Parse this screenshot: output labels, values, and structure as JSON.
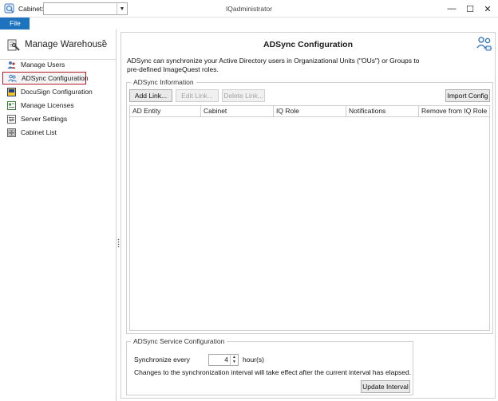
{
  "titlebar": {
    "cabinet_label": "Cabinet:",
    "cabinet_value": "",
    "window_title": "IQadministrator",
    "minimize_glyph": "—",
    "maximize_glyph": "☐",
    "close_glyph": "✕"
  },
  "menubar": {
    "file_label": "File"
  },
  "sidebar": {
    "title": "Manage Warehouse",
    "collapse_glyph": "⌃",
    "items": [
      {
        "label": "Manage Users",
        "icon": "users-icon"
      },
      {
        "label": "ADSync Configuration",
        "icon": "adsync-icon",
        "selected": true
      },
      {
        "label": "DocuSign Configuration",
        "icon": "docusign-icon"
      },
      {
        "label": "Manage Licenses",
        "icon": "license-icon"
      },
      {
        "label": "Server Settings",
        "icon": "server-settings-icon"
      },
      {
        "label": "Cabinet List",
        "icon": "cabinet-list-icon"
      }
    ]
  },
  "main": {
    "title": "ADSync Configuration",
    "description_line1": "ADSync can synchronize your Active Directory users in Organizational Units (\"OUs\") or Groups to",
    "description_line2": "pre-defined ImageQuest roles.",
    "info_group_label": "ADSync Information",
    "buttons": {
      "add_link": "Add Link...",
      "edit_link": "Edit Link...",
      "delete_link": "Delete Link...",
      "import_config": "Import Config"
    },
    "grid_columns": [
      "AD Entity",
      "Cabinet",
      "IQ Role",
      "Notifications",
      "Remove from IQ Role"
    ],
    "service_group_label": "ADSync Service Configuration",
    "sync_label": "Synchronize every",
    "sync_value": "4",
    "sync_unit": "hour(s)",
    "sync_note": "Changes to the synchronization interval will take effect after the current interval has elapsed.",
    "update_interval": "Update Interval"
  },
  "colors": {
    "accent": "#1e73be",
    "selected_border": "#b51c2c"
  }
}
